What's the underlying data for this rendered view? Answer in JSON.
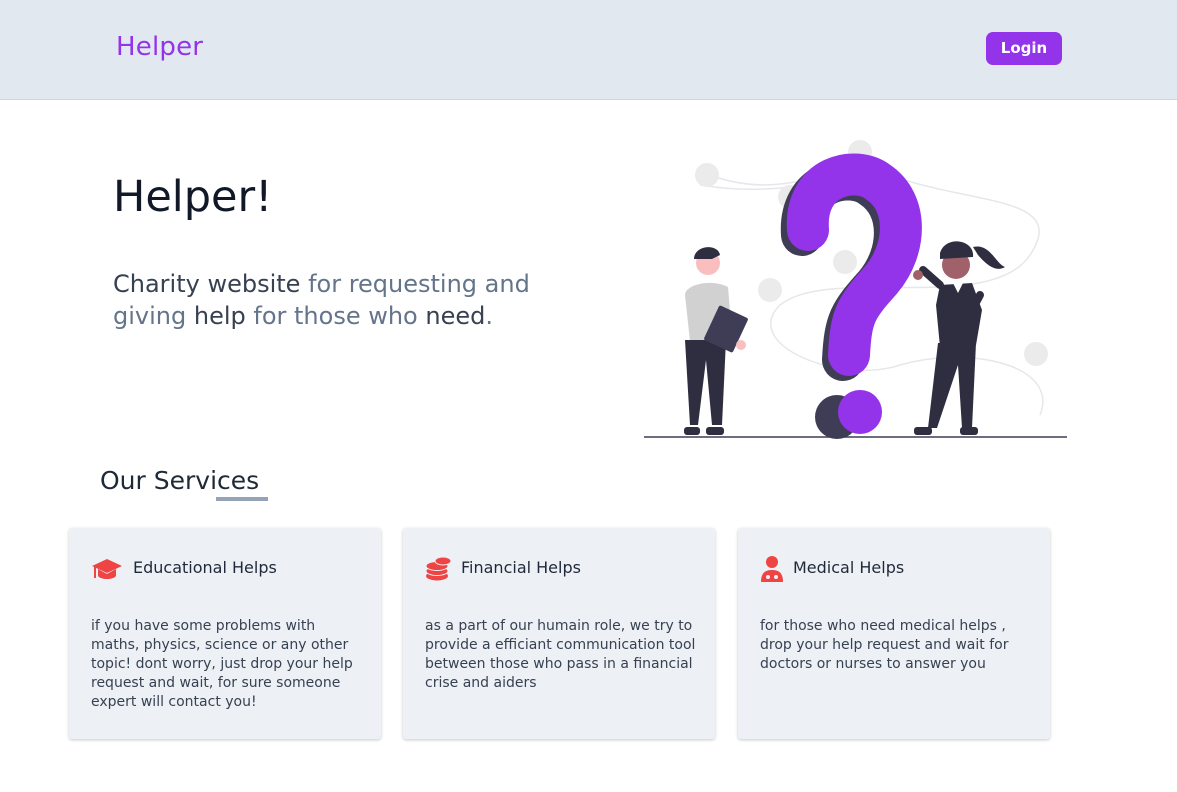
{
  "header": {
    "logo": "Helper",
    "login_label": "Login"
  },
  "hero": {
    "title": "Helper!",
    "subtitle_parts": [
      "Charity website ",
      "for requesting and giving ",
      "help",
      " for those who ",
      "need",
      "."
    ]
  },
  "illustration": {
    "name": "question-mark-people-illustration",
    "accent_color": "#9333ea"
  },
  "services": {
    "title": "Our Services",
    "cards": [
      {
        "title": "Educational Helps",
        "icon": "graduation-cap-icon",
        "text": "if you have some problems with maths, physics, science or any other topic! dont worry, just drop your help request and wait, for sure someone expert will contact you!"
      },
      {
        "title": "Financial Helps",
        "icon": "coins-icon",
        "text": "as a part of our humain role, we try to provide a efficiant communication tool between those who pass in a financial crise and aiders"
      },
      {
        "title": "Medical Helps",
        "icon": "doctor-icon",
        "text": "for those who need medical helps , drop your help request and wait for doctors or nurses to answer you"
      }
    ]
  },
  "colors": {
    "brand": "#9333ea",
    "header_bg": "#e2e8f0",
    "card_bg": "#edf1f6",
    "icon_red": "#ef4444"
  }
}
